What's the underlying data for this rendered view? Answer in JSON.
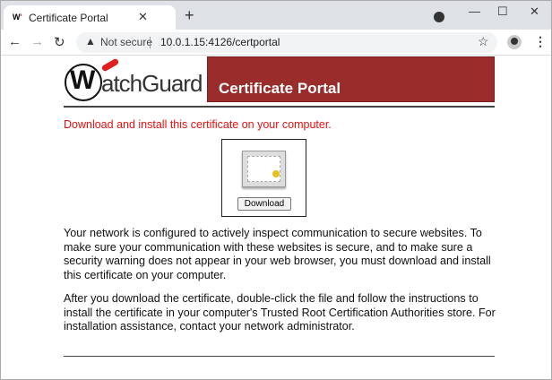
{
  "browser": {
    "tab_title": "Certificate Portal",
    "favicon_text": "W",
    "address_warning": "Not secure",
    "url": "10.0.1.15:4126/certportal",
    "new_tab": "+",
    "close": "✕"
  },
  "page": {
    "logo_text": "WatchGuard",
    "banner_title": "Certificate Portal",
    "instruction": "Download and install this certificate on your computer.",
    "download_label": "Download",
    "paragraph1": "Your network is configured to actively inspect communication to secure websites. To make sure your communication with these websites is secure, and to make sure a security warning does not appear in your web browser, you must download and install this certificate on your computer.",
    "paragraph2": "After you download the certificate, double-click the file and follow the instructions to install the certificate in your computer's Trusted Root Certification Authorities store. For installation assistance, contact your network administrator."
  }
}
